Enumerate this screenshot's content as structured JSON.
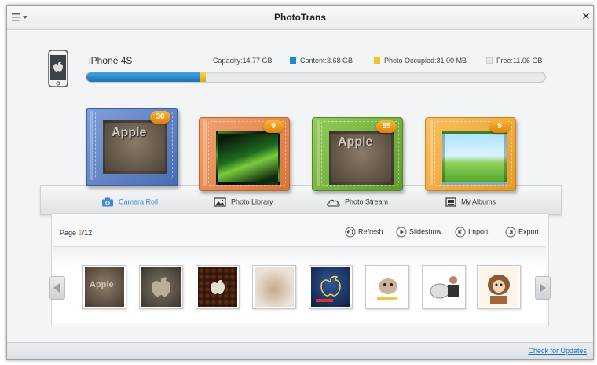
{
  "app": {
    "title": "PhotoTrans"
  },
  "window_controls": {
    "minimize": "–",
    "close": "✕"
  },
  "device": {
    "name": "iPhone 4S",
    "capacity": "Capacity:14.77 GB",
    "content": "Content:3.68 GB",
    "photo_occupied": "Photo Occupied:31.00 MB",
    "free": "Free:11.06 GB",
    "content_fraction": 0.249,
    "photo_fraction": 0.012,
    "colors": {
      "content": "#1e88d4",
      "photo": "#f2c12e",
      "free": "#e6e8ea"
    }
  },
  "albums": [
    {
      "label": "Camera Roll",
      "count": "30",
      "color": "#5b7fc4",
      "active": true,
      "icon": "camera-icon"
    },
    {
      "label": "Photo Library",
      "count": "9",
      "color": "#e3874a",
      "active": false,
      "icon": "image-icon"
    },
    {
      "label": "Photo Stream",
      "count": "55",
      "color": "#7ab443",
      "active": false,
      "icon": "cloud-icon"
    },
    {
      "label": "My Albums",
      "count": "9",
      "color": "#f0a93c",
      "active": false,
      "icon": "albums-icon"
    }
  ],
  "pager": {
    "label": "Page",
    "current": "1",
    "total": "/12"
  },
  "actions": {
    "refresh": "Refresh",
    "slideshow": "Slideshow",
    "import": "Import",
    "export": "Export"
  },
  "thumbnails": [
    {
      "name": "apple-stone"
    },
    {
      "name": "apple-cracked"
    },
    {
      "name": "apple-coffee"
    },
    {
      "name": "apple-collage"
    },
    {
      "name": "apple-blue"
    },
    {
      "name": "cartoon-1"
    },
    {
      "name": "cartoon-2"
    },
    {
      "name": "cartoon-3"
    }
  ],
  "footer": {
    "check_updates": "Check for Updates"
  }
}
